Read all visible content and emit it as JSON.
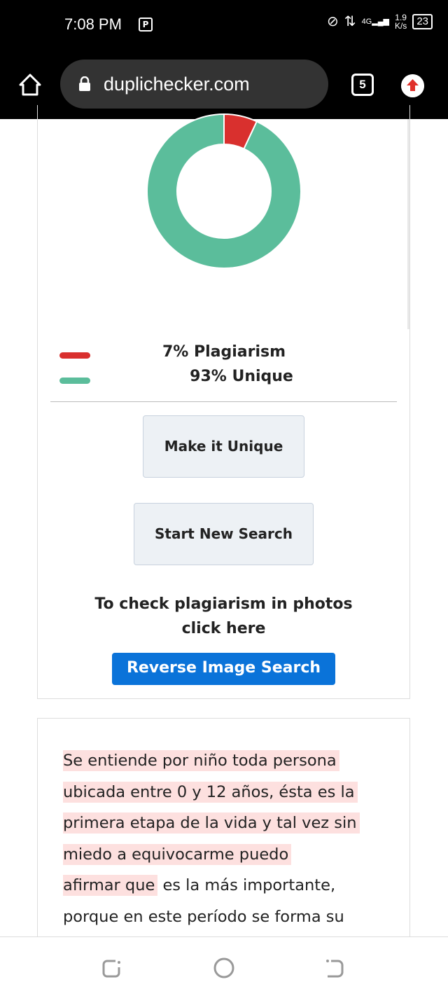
{
  "status_bar": {
    "time": "7:08 PM",
    "notification_icon": "P",
    "network": "4G",
    "speed_value": "1.9",
    "speed_unit": "K/s",
    "battery": "23"
  },
  "browser": {
    "url": "duplichecker.com",
    "tab_count": "5"
  },
  "chart_data": {
    "type": "pie",
    "variant": "donut",
    "values": [
      7,
      93
    ],
    "labels": [
      "Plagiarism",
      "Unique"
    ],
    "colors": [
      "#d9302e",
      "#5bbd9b"
    ]
  },
  "result": {
    "plagiarism_label": "7% Plagiarism",
    "unique_label": "93% Unique"
  },
  "buttons": {
    "make_unique": "Make it Unique",
    "new_search": "Start New Search",
    "reverse_image": "Reverse Image Search"
  },
  "photo_text": {
    "line1": "To check plagiarism in photos",
    "line2": "click here"
  },
  "paragraph": {
    "lines": [
      {
        "hl": "Se entiende por niño toda persona",
        "rest": ""
      },
      {
        "hl": "ubicada entre 0 y 12 años, ésta es la",
        "rest": ""
      },
      {
        "hl": "primera etapa de la vida y tal vez sin",
        "rest": ""
      },
      {
        "hl": "miedo a equivocarme puedo",
        "rest": ""
      },
      {
        "hl": "afirmar que",
        "rest": " es la más importante,"
      },
      {
        "hl": "",
        "rest": "porque en este período se forma su"
      }
    ]
  }
}
